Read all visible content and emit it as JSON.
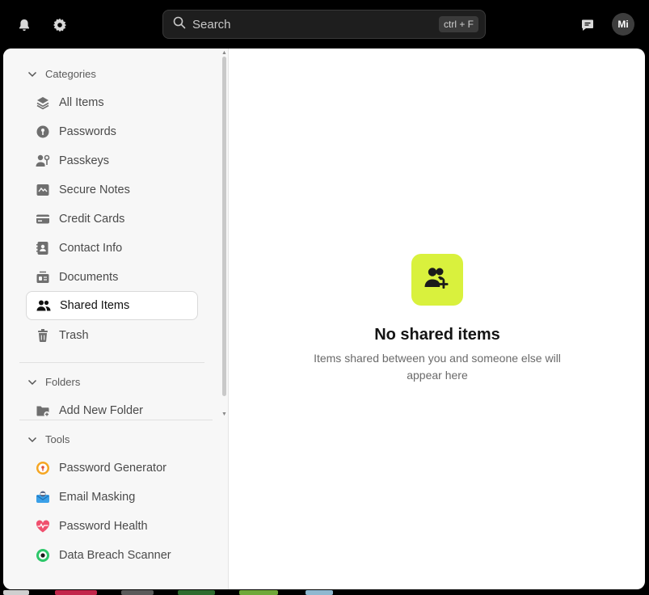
{
  "topbar": {
    "search_placeholder": "Search",
    "search_shortcut": "ctrl + F",
    "avatar_initials": "Mi"
  },
  "sidebar": {
    "categories_label": "Categories",
    "categories": [
      {
        "label": "All Items",
        "icon": "layers-icon"
      },
      {
        "label": "Passwords",
        "icon": "key-icon"
      },
      {
        "label": "Passkeys",
        "icon": "passkey-icon"
      },
      {
        "label": "Secure Notes",
        "icon": "note-icon"
      },
      {
        "label": "Credit Cards",
        "icon": "credit-card-icon"
      },
      {
        "label": "Contact Info",
        "icon": "contact-icon"
      },
      {
        "label": "Documents",
        "icon": "document-icon"
      },
      {
        "label": "Shared Items",
        "icon": "users-icon",
        "active": true
      },
      {
        "label": "Trash",
        "icon": "trash-icon"
      }
    ],
    "folders_label": "Folders",
    "add_folder_label": "Add New Folder",
    "tools_label": "Tools",
    "tools": [
      {
        "label": "Password Generator",
        "icon": "password-generator-icon"
      },
      {
        "label": "Email Masking",
        "icon": "email-masking-icon"
      },
      {
        "label": "Password Health",
        "icon": "password-health-icon"
      },
      {
        "label": "Data Breach Scanner",
        "icon": "data-breach-scanner-icon"
      }
    ]
  },
  "main": {
    "empty_title": "No shared items",
    "empty_subtitle": "Items shared between you and someone else will appear here"
  },
  "colors": {
    "accent": "#d9f13d",
    "sidebar_bg": "#f7f7f7",
    "topbar_bg": "#000000"
  }
}
